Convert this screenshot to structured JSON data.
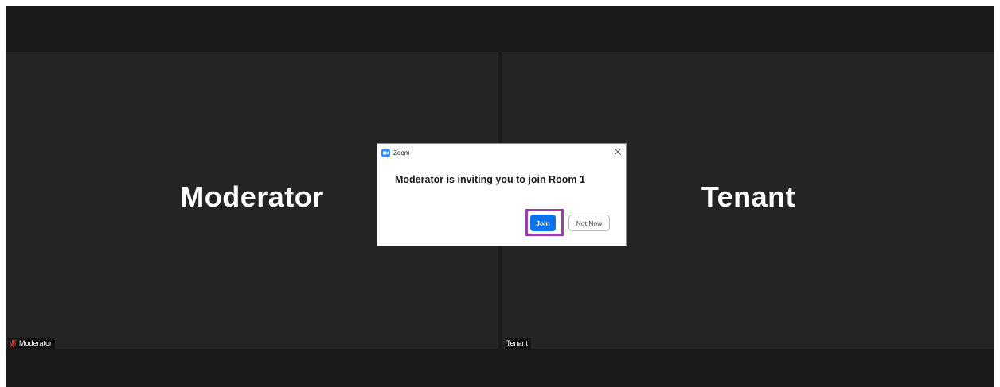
{
  "tiles": {
    "left": {
      "display_name": "Moderator",
      "label": "Moderator",
      "mic_icon": "muted-mic-icon"
    },
    "right": {
      "display_name": "Tenant",
      "label": "Tenant"
    }
  },
  "dialog": {
    "app_icon": "zoom-camera-icon",
    "title": "Zoom",
    "close_symbol": "×",
    "message": "Moderator is inviting you to join Room 1",
    "join_label": "Join",
    "not_now_label": "Not Now"
  },
  "colors": {
    "meeting_background": "#1a1a1a",
    "tile_background": "#242424",
    "join_button": "#0e72ed",
    "highlight": "#9b3fb0",
    "muted_icon": "#e02828"
  }
}
